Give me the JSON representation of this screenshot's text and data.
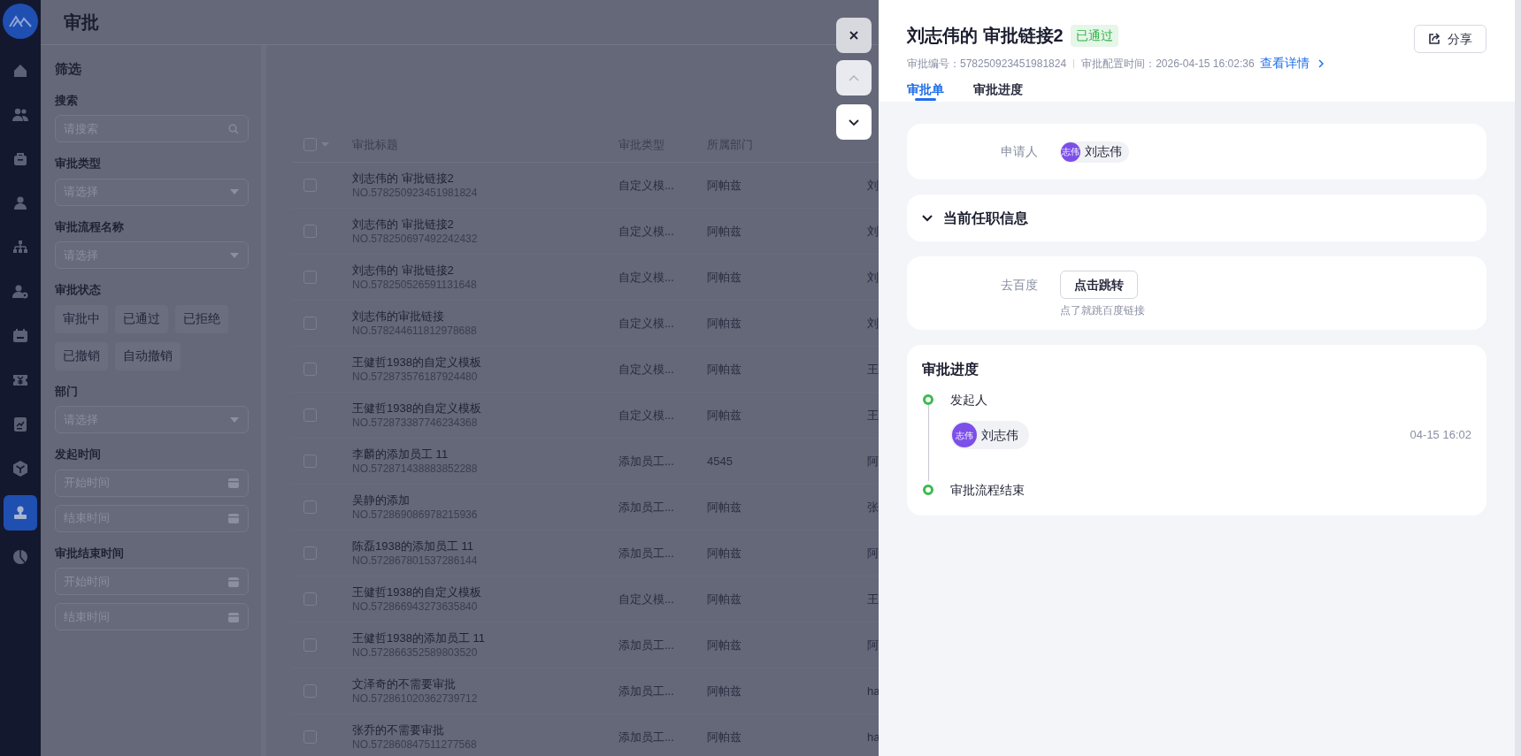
{
  "app": {
    "page_title": "审批"
  },
  "nav": [
    {
      "kind": "home",
      "selected": false
    },
    {
      "kind": "people",
      "selected": false
    },
    {
      "kind": "bag",
      "selected": false
    },
    {
      "kind": "person",
      "selected": false
    },
    {
      "kind": "org",
      "selected": false
    },
    {
      "kind": "person-add",
      "selected": false
    },
    {
      "kind": "calendar",
      "selected": false
    },
    {
      "kind": "ticket",
      "selected": false
    },
    {
      "kind": "chart",
      "selected": false
    },
    {
      "kind": "box",
      "selected": false
    },
    {
      "kind": "stamp",
      "selected": true
    },
    {
      "kind": "pie",
      "selected": false
    }
  ],
  "filters": {
    "title": "筛选",
    "groups": [
      {
        "label": "搜索",
        "fields": [
          {
            "kind": "search",
            "placeholder": "请搜索"
          }
        ]
      },
      {
        "label": "审批类型",
        "fields": [
          {
            "kind": "select",
            "placeholder": "请选择"
          }
        ]
      },
      {
        "label": "审批流程名称",
        "fields": [
          {
            "kind": "select",
            "placeholder": "请选择"
          }
        ]
      },
      {
        "label": "审批状态",
        "chips": [
          "审批中",
          "已通过",
          "已拒绝",
          "已撤销",
          "自动撤销"
        ]
      },
      {
        "label": "部门",
        "fields": [
          {
            "kind": "select",
            "placeholder": "请选择"
          }
        ]
      },
      {
        "label": "发起时间",
        "fields": [
          {
            "kind": "date",
            "placeholder": "开始时间"
          },
          {
            "kind": "date",
            "placeholder": "结束时间"
          }
        ]
      },
      {
        "label": "审批结束时间",
        "fields": [
          {
            "kind": "date",
            "placeholder": "开始时间"
          },
          {
            "kind": "date",
            "placeholder": "结束时间"
          }
        ]
      }
    ]
  },
  "table": {
    "select_all": {
      "checked": false
    },
    "columns": [
      "审批标题",
      "审批类型",
      "所属部门"
    ],
    "rows": [
      {
        "checked": false,
        "title": "刘志伟的 审批链接2",
        "number": "NO.578250923451981824",
        "type": "自定义模...",
        "department": "阿帕兹",
        "column_5": "刘"
      },
      {
        "checked": false,
        "title": "刘志伟的 审批链接2",
        "number": "NO.578250697492242432",
        "type": "自定义模...",
        "department": "阿帕兹",
        "column_5": "刘"
      },
      {
        "checked": false,
        "title": "刘志伟的 审批链接2",
        "number": "NO.578250526591131648",
        "type": "自定义模...",
        "department": "阿帕兹",
        "column_5": "刘"
      },
      {
        "checked": false,
        "title": "刘志伟的审批链接",
        "number": "NO.578244611812978688",
        "type": "自定义模...",
        "department": "阿帕兹",
        "column_5": "刘"
      },
      {
        "checked": false,
        "title": "王健哲1938的自定义模板",
        "number": "NO.572873576187924480",
        "type": "自定义模...",
        "department": "阿帕兹",
        "column_5": "王"
      },
      {
        "checked": false,
        "title": "王健哲1938的自定义模板",
        "number": "NO.572873387746234368",
        "type": "自定义模...",
        "department": "阿帕兹",
        "column_5": "王"
      },
      {
        "checked": false,
        "title": "李麟的添加员工 11",
        "number": "NO.572871438883852288",
        "type": "添加员工...",
        "department": "4545",
        "column_5": "阿"
      },
      {
        "checked": false,
        "title": "吴静的添加",
        "number": "NO.572869086978215936",
        "type": "添加员工...",
        "department": "阿帕兹",
        "column_5": "张"
      },
      {
        "checked": false,
        "title": "陈磊1938的添加员工 11",
        "number": "NO.572867801537286144",
        "type": "添加员工...",
        "department": "阿帕兹",
        "column_5": "阿"
      },
      {
        "checked": false,
        "title": "王健哲1938的自定义模板",
        "number": "NO.572866943273635840",
        "type": "自定义模...",
        "department": "阿帕兹",
        "column_5": "王"
      },
      {
        "checked": false,
        "title": "王健哲1938的添加员工 11",
        "number": "NO.572866352589803520",
        "type": "添加员工...",
        "department": "阿帕兹",
        "column_5": "阿"
      },
      {
        "checked": false,
        "title": "文泽奇的不需要审批",
        "number": "NO.572861020362739712",
        "type": "添加员工...",
        "department": "阿帕兹",
        "column_5": "ha"
      },
      {
        "checked": false,
        "title": "张乔的不需要审批",
        "number": "NO.572860847511277568",
        "type": "添加员工...",
        "department": "阿帕兹",
        "column_5": "ha"
      }
    ]
  },
  "drawer_controls": [
    {
      "kind": "close",
      "disabled": false
    },
    {
      "kind": "up",
      "disabled": true
    },
    {
      "kind": "down",
      "disabled": false
    }
  ],
  "drawer": {
    "title": "刘志伟的 审批链接2",
    "status": "已通过",
    "meta": [
      "审批编号：578250923451981824",
      "审批配置时间：2026-04-15 16:02:36"
    ],
    "detail_link": "查看详情",
    "share": "分享",
    "tabs": [
      {
        "label": "审批单",
        "selected": true
      },
      {
        "label": "审批进度",
        "selected": false
      }
    ],
    "applicant": {
      "label": "申请人",
      "avatar": "志伟",
      "name": "刘志伟"
    },
    "section": {
      "title": "当前任职信息"
    },
    "link_field": {
      "label": "去百度",
      "button": "点击跳转",
      "hint": "点了就跳百度链接"
    },
    "progress": {
      "title": "审批进度",
      "steps": [
        {
          "label": "发起人",
          "person": {
            "avatar": "志伟",
            "name": "刘志伟"
          },
          "time": "04-15 16:02"
        },
        {
          "label": "审批流程结束"
        }
      ]
    }
  }
}
